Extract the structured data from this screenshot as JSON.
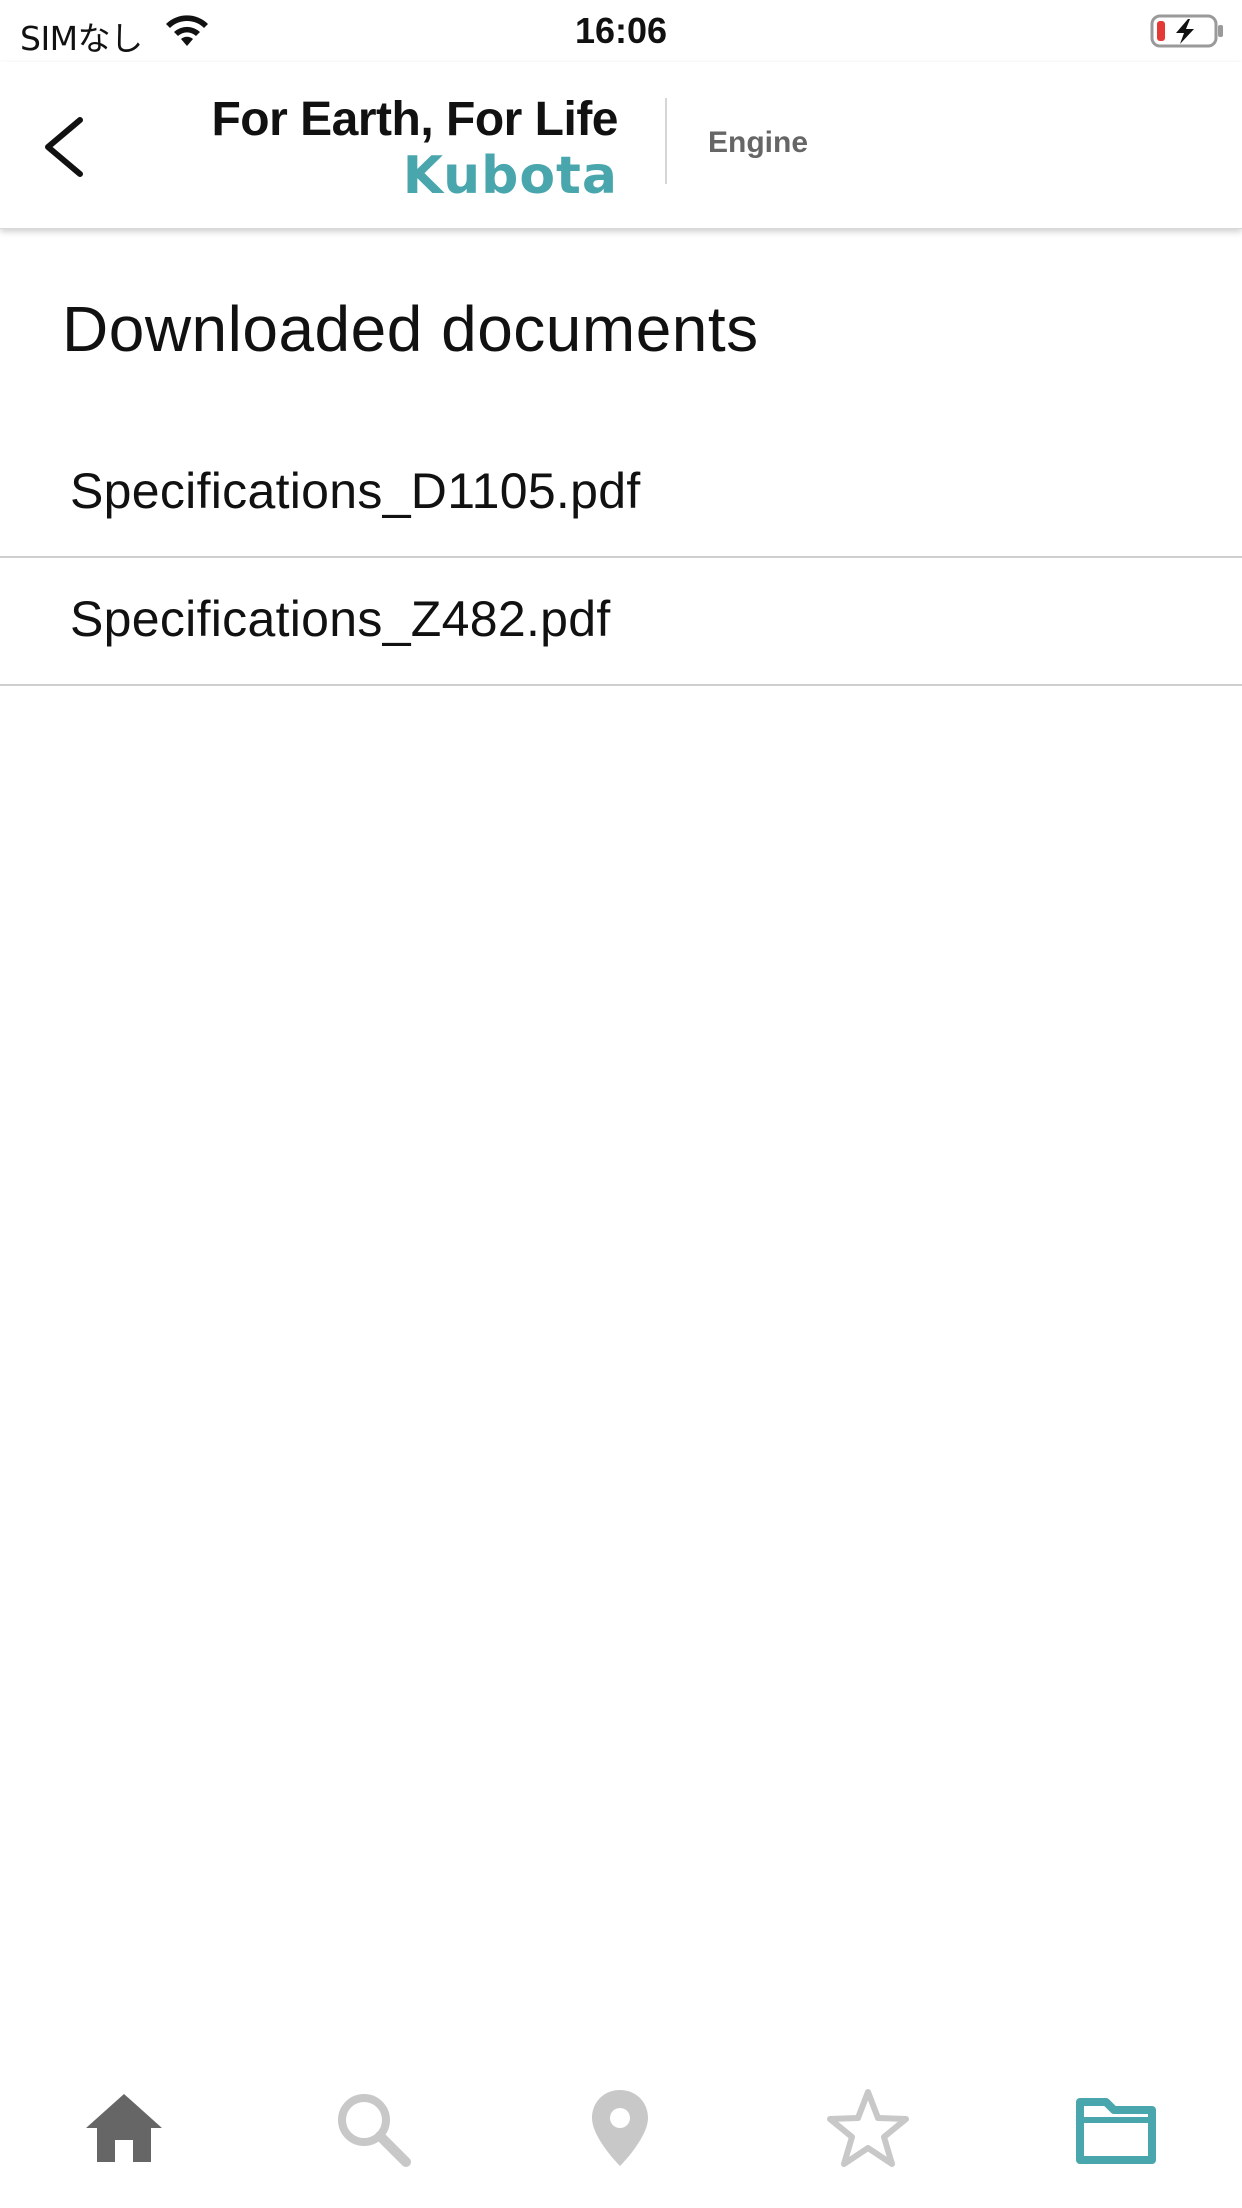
{
  "status_bar": {
    "carrier": "SIMなし",
    "time": "16:06",
    "icons": [
      "wifi-icon",
      "battery-charging-icon"
    ]
  },
  "header": {
    "back_icon": "chevron-left-icon",
    "slogan": "For Earth, For Life",
    "brand": "Kubota",
    "category": "Engine"
  },
  "main": {
    "title": "Downloaded documents",
    "documents": [
      {
        "name": "Specifications_D1105.pdf"
      },
      {
        "name": "Specifications_Z482.pdf"
      }
    ]
  },
  "tab_bar": {
    "tabs": [
      {
        "icon": "home-icon",
        "active": false
      },
      {
        "icon": "search-icon",
        "active": false
      },
      {
        "icon": "location-pin-icon",
        "active": false
      },
      {
        "icon": "star-icon",
        "active": false
      },
      {
        "icon": "folder-icon",
        "active": true
      }
    ]
  },
  "colors": {
    "accent": "#4aa6ad",
    "home_icon": "#666666",
    "inactive_icon": "#c8c8c8",
    "battery_low": "#e53935"
  }
}
